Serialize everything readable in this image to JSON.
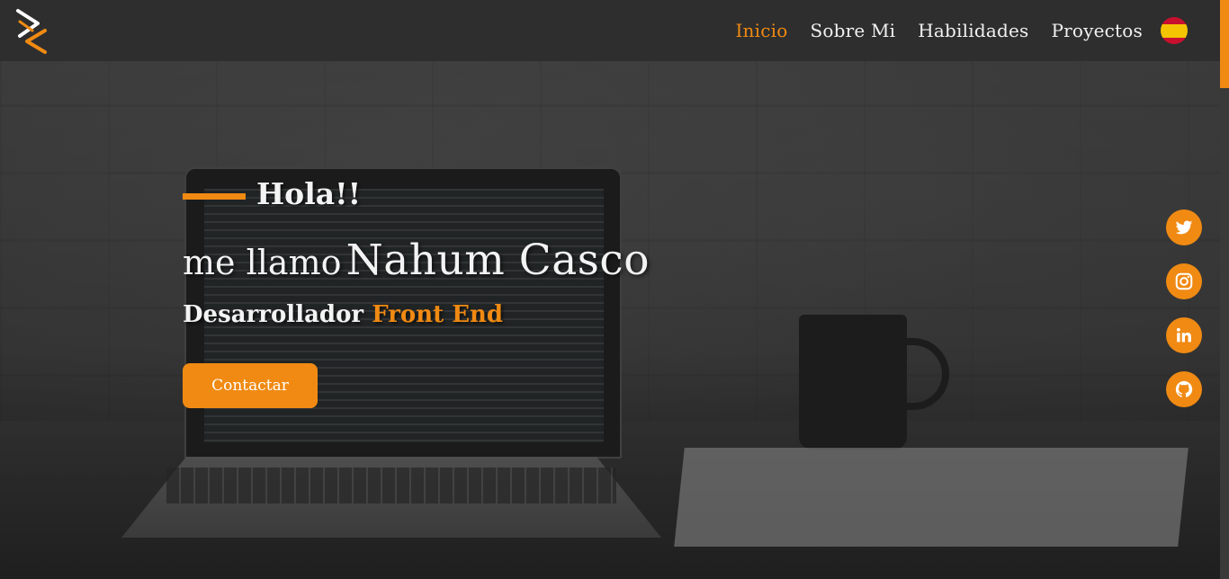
{
  "nav": {
    "links": [
      "Inicio",
      "Sobre Mi",
      "Habilidades",
      "Proyectos"
    ],
    "active": "Inicio"
  },
  "hero": {
    "greeting": "Hola!!",
    "name_prefix": "me llamo",
    "name": "Nahum Casco",
    "role_prefix": "Desarrollador",
    "role_accent": "Front End",
    "contact_button": "Contactar"
  },
  "social": [
    "twitter-icon",
    "instagram-icon",
    "linkedin-icon",
    "github-icon"
  ],
  "colors": {
    "accent": "#f08a13",
    "navbar": "#2e2e2e",
    "text": "#f3f3f3"
  },
  "language_flag": "spain-flag-icon"
}
